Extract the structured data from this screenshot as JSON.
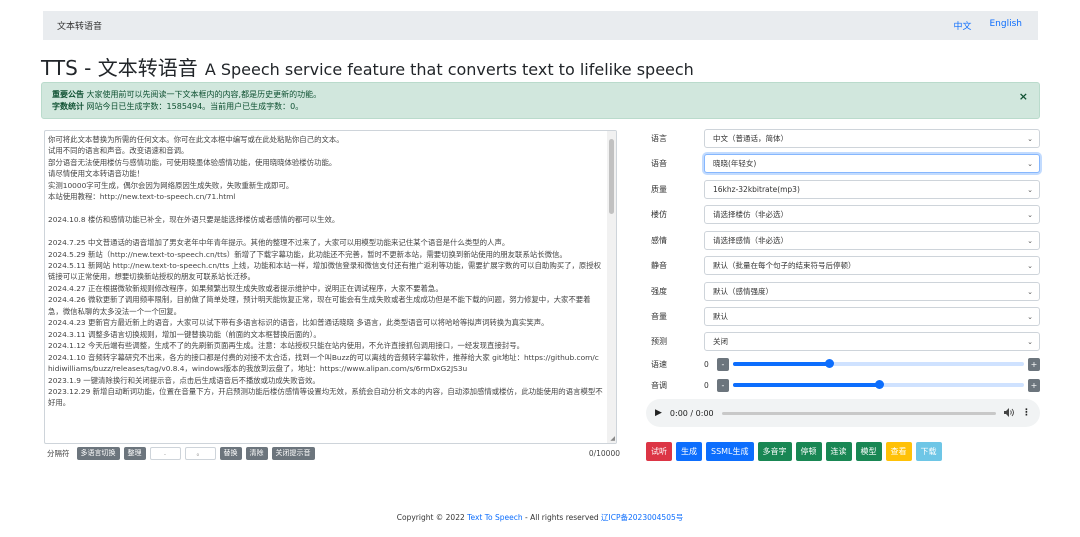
{
  "nav": {
    "brand": "文本转语音",
    "lang_zh": "中文",
    "lang_en": "English"
  },
  "title": {
    "main": "TTS - 文本转语音",
    "sub": "A Speech service feature that converts text to lifelike speech"
  },
  "alert": {
    "notice_label": "重要公告",
    "notice_text": "大家使用前可以先阅读一下文本框内的内容,都是历史更新的功能。",
    "stats_label": "字数统计",
    "stats_text": "网站今日已生成字数：1585494。当前用户已生成字数：0。",
    "close": "×"
  },
  "textarea": {
    "content": "你可将此文本替换为所需的任何文本。你可在此文本框中编写或在此处粘贴你自己的文本。\n试用不同的语言和声音。改变语速和音调。\n部分语音无法使用楼仿与感情功能，可使用晓墨体验感情功能，使用晓晓体验楼仿功能。\n请尽情使用文本转语音功能！\n实测10000字可生成，偶尔会因为网络原因生成失败，失败重新生成即可。\n本站使用教程：http://new.text-to-speech.cn/71.html\n\n2024.10.8 楼仿和感情功能已补全，现在外语只要是能选择楼仿或者感情的都可以生效。\n\n2024.7.25 中文普通话的语音增加了男女老年中年青年提示。其他的整理不过来了，大家可以用模型功能来记住某个语音是什么类型的人声。\n2024.5.29 新站（http://new.text-to-speech.cn/tts）新增了下载字幕功能，此功能还不完善，暂时不更新本站，需要切换到新站使用的朋友联系站长微信。\n2024.5.11 新网站 http://new.text-to-speech.cn/tts 上线，功能和本站一样，增加微信登录和微信支付还有推广返利等功能，需要扩展字数的可以自助购买了，原授权链接可以正常使用，想要切换新站授权的朋友可联系站长迁移。\n2024.4.27 正在根据微软新规则修改程序，如果频繁出现生成失败或者提示维护中，说明正在调试程序，大家不要着急。\n2024.4.26 微软更新了调用频率限制，目前做了简单处理，预计明天能恢复正常，现在可能会有生成失败或者生成成功但是不能下载的问题，努力修复中，大家不要着急，微信私聊的太多没法一个一个回复。\n2024.4.23 更新官方最近新上的语音，大家可以试下带有多语言标识的语音，比如普通话晓晓 多语言，此类型语音可以将哈哈等拟声词转换为真实笑声。\n2024.3.11 调整多语言切换规则，增加一键替换功能（前面的文本框替换后面的）。\n2024.1.12 今天后端有些调整，生成不了的先刷新页面再生成。注意：本站授权只能在站内使用，不允许直接抓包调用接口，一经发现直接封号。\n2024.1.10 音频转字幕研究不出来，各方的接口都是付费的对接不太合适，找到一个叫Buzz的可以离线的音频转字幕软件，推荐给大家 git地址：https://github.com/chidiwilliams/buzz/releases/tag/v0.8.4，windows版本的我放到云盘了，地址：https://www.alipan.com/s/6rmDxG2JS3u\n2023.1.9 一键清除换行和关闭提示音，点击后生成语音后不播放或功成失败音效。\n2023.12.29 新增自动断词功能，位置在音量下方，开启预测功能后楼仿感情等设置均无效，系统会自动分析文本的内容，自动添加感情或楼仿，此功能使用的语言模型不好用。"
  },
  "toolbar": {
    "label": "分隔符",
    "btn1": "多语言切换",
    "btn2": "整理",
    "input1_placeholder": ".",
    "input2_placeholder": "。",
    "btn3": "替换",
    "btn4": "清除",
    "btn5": "关闭提示音",
    "count": "0/10000"
  },
  "form": [
    {
      "label": "语言",
      "value": "中文（普通话，简体）",
      "focus": false
    },
    {
      "label": "语音",
      "value": "晓晓(年轻女)",
      "focus": true
    },
    {
      "label": "质量",
      "value": "16khz-32kbitrate(mp3)",
      "focus": false
    },
    {
      "label": "楼仿",
      "value": "请选择楼仿（非必选）",
      "focus": false
    },
    {
      "label": "感情",
      "value": "请选择感情（非必选）",
      "focus": false
    },
    {
      "label": "静音",
      "value": "默认（批量在每个句子的结束符号后停顿）",
      "focus": false
    },
    {
      "label": "强度",
      "value": "默认（感情强度）",
      "focus": false
    },
    {
      "label": "音量",
      "value": "默认",
      "focus": false
    },
    {
      "label": "预测",
      "value": "关闭",
      "focus": false
    }
  ],
  "sliders": [
    {
      "label": "语速",
      "value": "0",
      "minus": "-",
      "plus": "+",
      "level": 0.33
    },
    {
      "label": "音调",
      "value": "0",
      "minus": "-",
      "plus": "+",
      "level": 0.5
    }
  ],
  "audio": {
    "play_icon": "▶",
    "time": "0:00 / 0:00",
    "more_icon": "⋮"
  },
  "buttons": [
    {
      "label": "试听",
      "color": "#dc3545"
    },
    {
      "label": "生成",
      "color": "#0d6efd"
    },
    {
      "label": "SSML生成",
      "color": "#0d6efd"
    },
    {
      "label": "多音字",
      "color": "#198754"
    },
    {
      "label": "停顿",
      "color": "#198754"
    },
    {
      "label": "连读",
      "color": "#198754"
    },
    {
      "label": "模型",
      "color": "#198754"
    },
    {
      "label": "查看",
      "color": "#ffc107"
    },
    {
      "label": "下载",
      "color": "#6ec6e6"
    }
  ],
  "footer": {
    "prefix": "Copyright © 2022",
    "link": "Text To Speech",
    "middle": "- All rights reserved",
    "icp": "辽ICP备2023004505号"
  }
}
